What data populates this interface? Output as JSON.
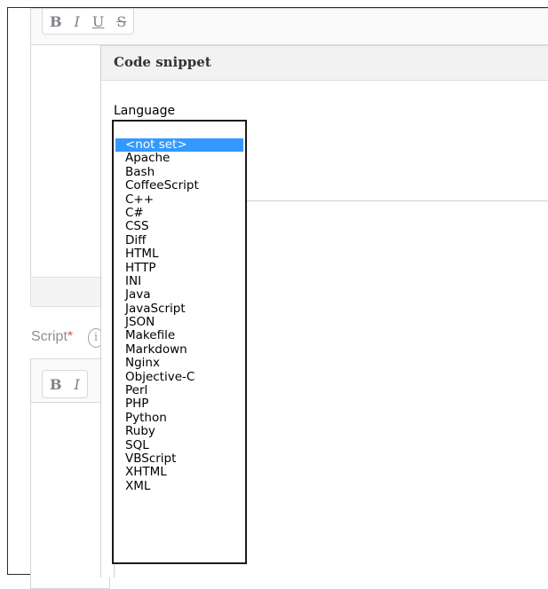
{
  "editor_top": {
    "toolbar": {
      "bold": "B",
      "italic": "I",
      "underline": "U",
      "strike": "S"
    }
  },
  "script_field": {
    "label": "Script",
    "required_mark": "*",
    "info_icon": "i",
    "toolbar": {
      "bold": "B",
      "italic": "I"
    }
  },
  "dialog": {
    "title": "Code snippet",
    "language_label": "Language",
    "languages": [
      "<not set>",
      "Apache",
      "Bash",
      "CoffeeScript",
      "C++",
      "C#",
      "CSS",
      "Diff",
      "HTML",
      "HTTP",
      "INI",
      "Java",
      "JavaScript",
      "JSON",
      "Makefile",
      "Markdown",
      "Nginx",
      "Objective-C",
      "Perl",
      "PHP",
      "Python",
      "Ruby",
      "SQL",
      "VBScript",
      "XHTML",
      "XML"
    ],
    "selected_language": "<not set>"
  },
  "colors": {
    "selection": "#3399ff",
    "required": "#e55353",
    "muted_text": "#8b8f94"
  }
}
